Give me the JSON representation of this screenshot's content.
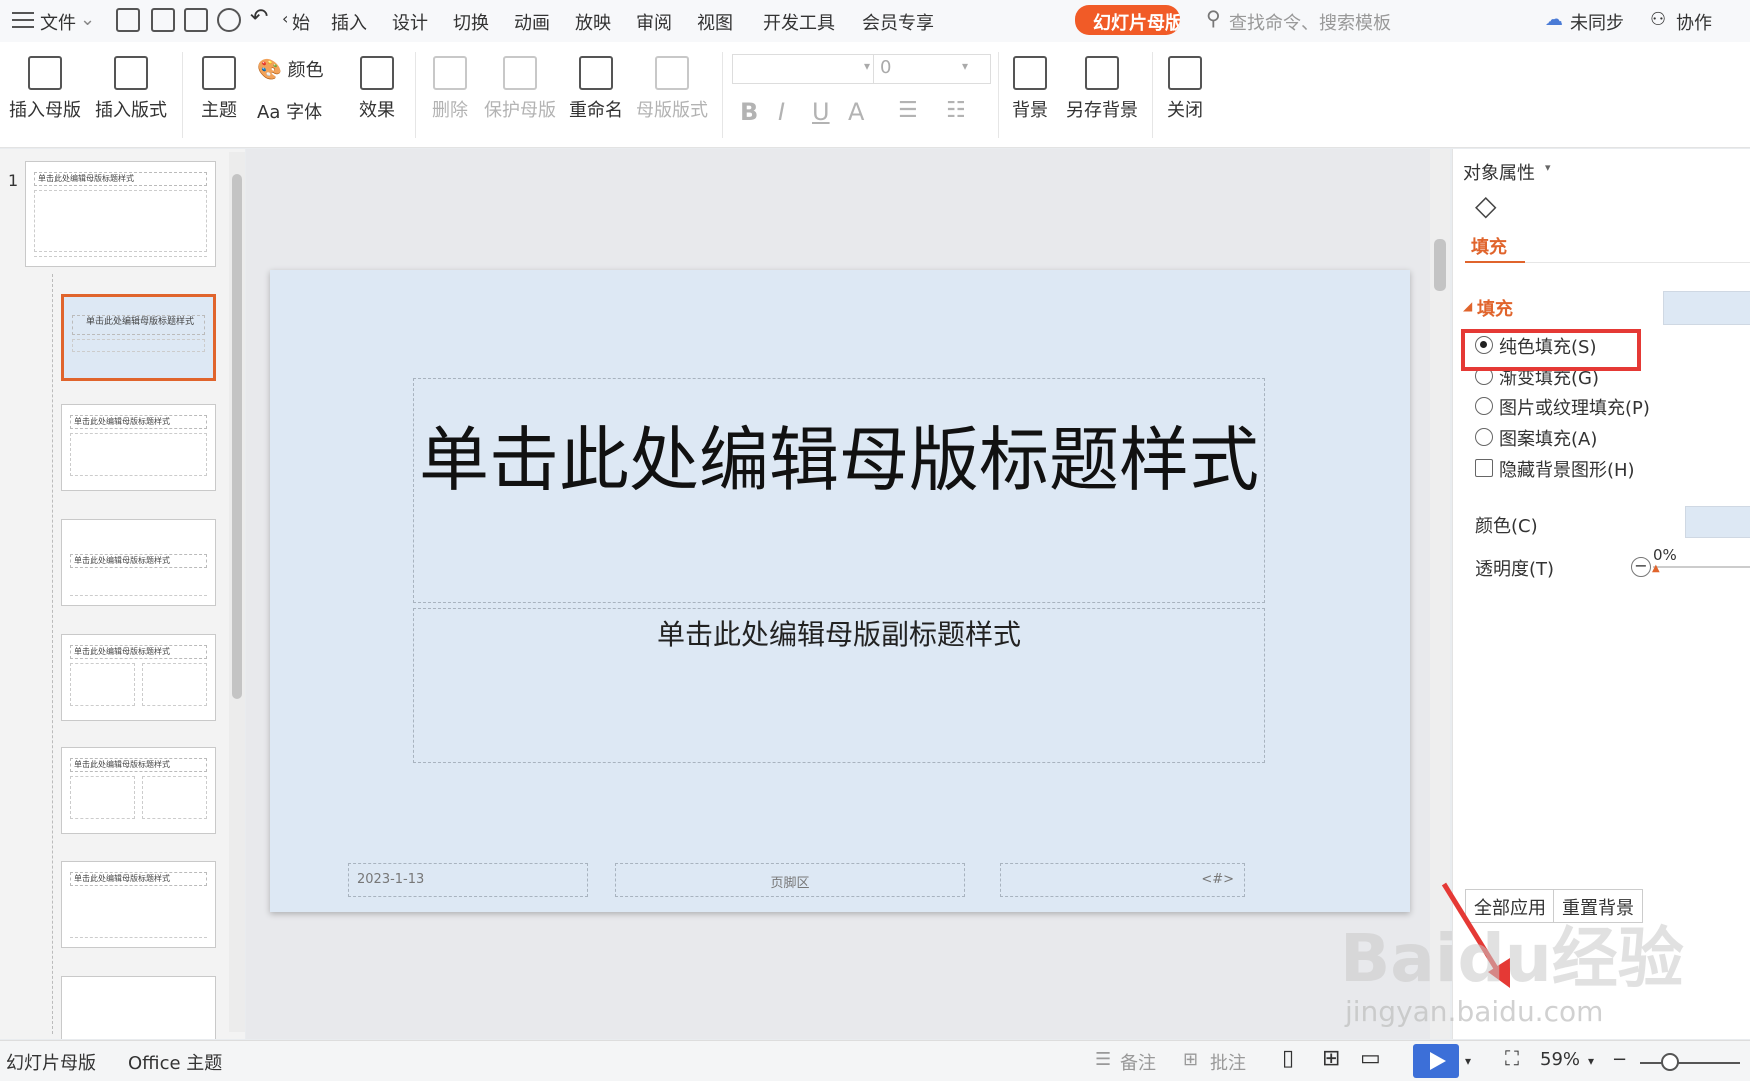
{
  "topbar": {
    "file": "文件",
    "tabs": [
      "插入",
      "设计",
      "切换",
      "动画",
      "放映",
      "审阅",
      "视图",
      "开发工具",
      "会员专享"
    ],
    "active_tab": "幻灯片母版",
    "search_placeholder": "查找命令、搜索模板",
    "sync": "未同步",
    "collab": "协作",
    "partial_tab": "始"
  },
  "ribbon": {
    "insert_master": "插入母版",
    "insert_layout": "插入版式",
    "theme": "主题",
    "colors": "颜色",
    "fonts": "字体",
    "effects": "效果",
    "delete": "删除",
    "protect_master": "保护母版",
    "rename": "重命名",
    "master_layout": "母版版式",
    "font_size_value": "0",
    "background": "背景",
    "save_background": "另存背景",
    "close": "关闭"
  },
  "thumbnails": {
    "first_index": "1",
    "title_text": "单击此处编辑母版标题样式",
    "alt_title_text": "单击此处编辑母版文本样式"
  },
  "slide": {
    "title": "单击此处编辑母版标题样式",
    "subtitle": "单击此处编辑母版副标题样式",
    "date": "2023-1-13",
    "footer": "页脚区",
    "page_num": "<#>"
  },
  "props": {
    "header": "对象属性",
    "tab_fill": "填充",
    "section_fill": "填充",
    "options": [
      {
        "label": "纯色填充(S)",
        "selected": true
      },
      {
        "label": "渐变填充(G)",
        "selected": false
      },
      {
        "label": "图片或纹理填充(P)",
        "selected": false
      },
      {
        "label": "图案填充(A)",
        "selected": false
      }
    ],
    "hide_bg_shapes": "隐藏背景图形(H)",
    "color_label": "颜色(C)",
    "transparency_label": "透明度(T)",
    "transparency_value": "0%",
    "apply_all": "全部应用",
    "reset_background": "重置背景"
  },
  "statusbar": {
    "mode": "幻灯片母版",
    "theme": "Office 主题",
    "notes": "备注",
    "comments": "批注",
    "zoom": "59%"
  },
  "watermark": {
    "brand": "Baidu经验",
    "url": "jingyan.baidu.com"
  },
  "colors": {
    "accent": "#f15b27",
    "slide_bg": "#dde8f4",
    "highlight": "#e53935"
  }
}
